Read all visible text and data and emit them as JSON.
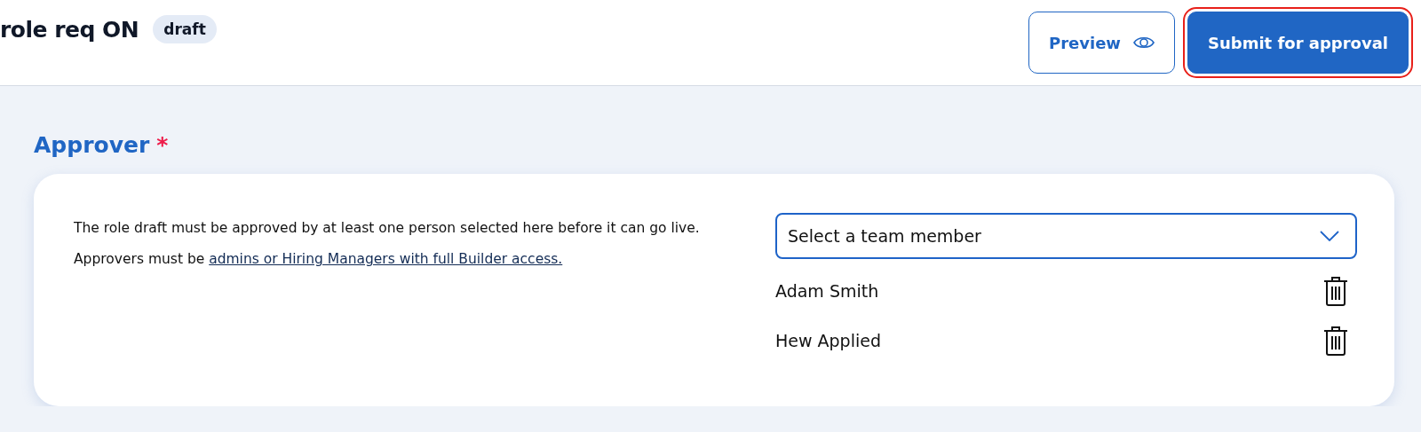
{
  "header": {
    "title": "role req ON",
    "status_badge": "draft",
    "buttons": [
      {
        "label": "Preview",
        "kind": "outline",
        "highlighted": false
      },
      {
        "label": "Submit for approval",
        "kind": "primary",
        "highlighted": true
      }
    ]
  },
  "approver": {
    "heading": "Approver",
    "required_mark": "*",
    "description": "The role draft must be approved by at least one person selected here before it can go live. Approvers must be ",
    "description_link": "admins or Hiring Managers with full Builder access.",
    "select": {
      "placeholder": "Select a team member"
    },
    "approvers": [
      {
        "name": "Adam Smith"
      },
      {
        "name": "Hew Applied"
      }
    ]
  }
}
